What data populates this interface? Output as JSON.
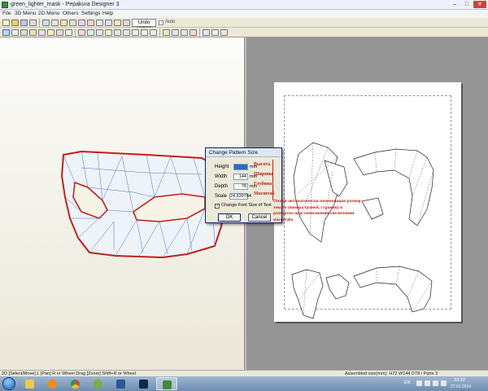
{
  "window": {
    "title": "green_lighter_mask - Pepakura Designer 3",
    "minimize": "–",
    "maximize": "□",
    "close": "✕"
  },
  "menu": [
    "File",
    "3D Menu",
    "2D Menu",
    "Others",
    "Settings",
    "Help"
  ],
  "toolbar": {
    "undo_unfold": "Undo Unfold",
    "auto_label": "Auto"
  },
  "dialog": {
    "title": "Change Pattern Size",
    "height_label": "Height",
    "height_value": "",
    "width_label": "Width",
    "width_value": "144",
    "depth_label": "Depth",
    "depth_value": "78",
    "scale_label": "Scale",
    "scale_value": "24.539784",
    "unit": "mm",
    "checkbox_label": "Change Font Size of Text",
    "checkbox_checked": true,
    "ok": "OK",
    "cancel": "Cancel"
  },
  "annotations": {
    "height": "Высота",
    "width": "Ширина",
    "depth": "Глубина",
    "scale": "Масштаб",
    "note": "Опция автоматически изменяющая размер текста (номера граней, страниц) в разверткe при уменьшении/увеличении масштаба"
  },
  "status": {
    "left": "2D [Select/Move] L [Pan] R or Wheel Drag [Zoom] Shift+R or Wheel",
    "right": "Assembled size(mm): H72 W144 D78 / Parts 3"
  },
  "taskbar": {
    "lang": "EN",
    "time": "23:22",
    "date": "27.01.2014"
  },
  "colors": {
    "mask_outline": "#c0201a",
    "mask_fill": "#eef3fa",
    "annotation": "#c0201a",
    "dialog_selection": "#3169c6"
  },
  "icons": [
    "windows-start-icon",
    "explorer-icon",
    "media-player-icon",
    "chrome-icon",
    "utorrent-icon",
    "word-icon",
    "photoshop-icon",
    "pepakura-icon"
  ]
}
